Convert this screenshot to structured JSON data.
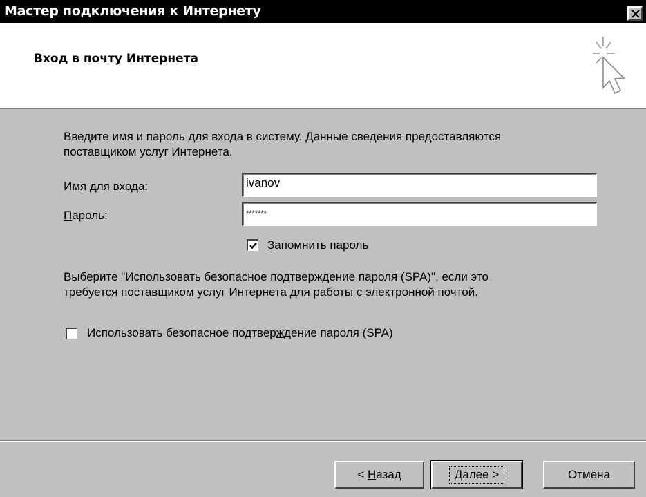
{
  "window": {
    "title": "Мастер подключения к Интернету"
  },
  "header": {
    "title": "Вход в почту Интернета"
  },
  "body": {
    "intro_line1": "Введите имя и пароль для входа в систему. Данные сведения предоставляются",
    "intro_line2": "поставщиком услуг Интернета.",
    "username_label_a": "Имя для в",
    "username_label_u": "х",
    "username_label_b": "ода:",
    "username_value": "ivanov",
    "password_label_u": "П",
    "password_label_b": "ароль:",
    "password_value": "*******",
    "remember_label_u": "З",
    "remember_label_b": "апомнить пароль",
    "remember_checked": true,
    "spa_note_line1": "Выберите \"Использовать безопасное подтверждение пароля (SPA)\", если это",
    "spa_note_line2": "требуется поставщиком услуг Интернета для работы с электронной почтой.",
    "spa_label_a": "Использовать безопасное подтвер",
    "spa_label_u": "ж",
    "spa_label_b": "дение пароля (SPA)",
    "spa_checked": false
  },
  "footer": {
    "back_prefix": "< ",
    "back_u": "Н",
    "back_rest": "азад",
    "next_u": "Д",
    "next_rest": "алее >",
    "cancel_label": "Отмена"
  },
  "colors": {
    "dialog_face": "#c0c0c0",
    "title_bar": "#000000",
    "header_bg": "#ffffff"
  },
  "icons": {
    "close": "close-icon",
    "wizard": "cursor-sparkle-icon",
    "check": "checkmark-icon"
  }
}
